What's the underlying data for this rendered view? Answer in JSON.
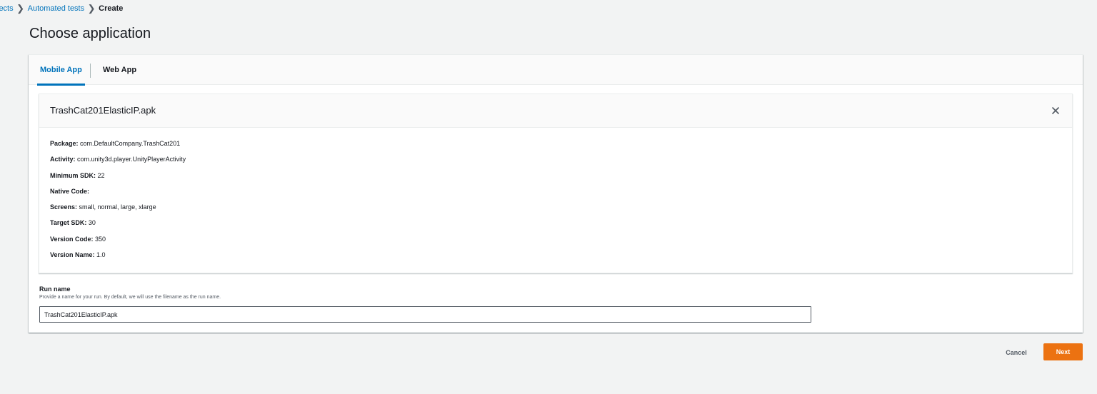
{
  "breadcrumb": {
    "items": [
      "jects",
      "Automated tests",
      "Create"
    ]
  },
  "page": {
    "title": "Choose application"
  },
  "tabs": [
    {
      "label": "Mobile App",
      "active": true
    },
    {
      "label": "Web App",
      "active": false
    }
  ],
  "file_card": {
    "file_name": "TrashCat201ElasticIP.apk",
    "close_icon": "close-icon",
    "details": [
      {
        "key": "Package:",
        "value": "com.DefaultCompany.TrashCat201"
      },
      {
        "key": "Activity:",
        "value": "com.unity3d.player.UnityPlayerActivity"
      },
      {
        "key": "Minimum SDK:",
        "value": "22"
      },
      {
        "key": "Native Code:",
        "value": ""
      },
      {
        "key": "Screens:",
        "value": "small, normal, large, xlarge"
      },
      {
        "key": "Target SDK:",
        "value": "30"
      },
      {
        "key": "Version Code:",
        "value": "350"
      },
      {
        "key": "Version Name:",
        "value": "1.0"
      }
    ]
  },
  "run_name": {
    "label": "Run name",
    "description": "Provide a name for your run. By default, we will use the filename as the run name.",
    "value": "TrashCat201ElasticIP.apk"
  },
  "footer": {
    "cancel_label": "Cancel",
    "next_label": "Next"
  },
  "colors": {
    "accent": "#0073bb",
    "primary_button": "#ec7211",
    "background": "#f2f3f3"
  }
}
